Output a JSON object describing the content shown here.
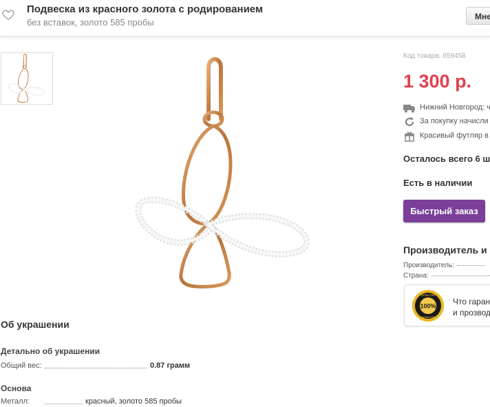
{
  "header": {
    "title": "Подвеска из красного золота с родированием",
    "subtitle": "без вставок, золото 585 пробы",
    "right_button": "Мне"
  },
  "product": {
    "code_label": "Код товара: 659458",
    "price": "1 300 р.",
    "info": [
      {
        "icon": "truck-icon",
        "text": "Нижний Новгород: ч"
      },
      {
        "icon": "refresh-icon",
        "text": "За покупку начисли"
      },
      {
        "icon": "gift-icon",
        "text": "Красивый футляр в"
      }
    ],
    "stock_left": "Осталось всего 6 ш",
    "availability": "Есть в наличии",
    "quick_order": "Быстрый заказ"
  },
  "manufacturer": {
    "title": "Производитель и",
    "producer_label": "Производитель:",
    "country_label": "Страна:"
  },
  "guarantee": {
    "line1": "Что гаран",
    "line2": "и прозвод",
    "seal_top": "ГАРАНТИЯ",
    "seal_pct": "100%",
    "seal_bottom": "ГАРАНТИЯ"
  },
  "about": {
    "title": "Об украшении",
    "detail_title": "Детально об украшении",
    "weight_label": "Общий вес:",
    "weight_value": "0.87 грамм",
    "base_title": "Основа",
    "metal_label": "Металл:",
    "metal_value": "красный, золото 585 пробы"
  },
  "colors": {
    "price": "#e0404e",
    "button": "#7b3f9a",
    "gold": "#c98a4e",
    "silver": "#e4e4e4"
  }
}
